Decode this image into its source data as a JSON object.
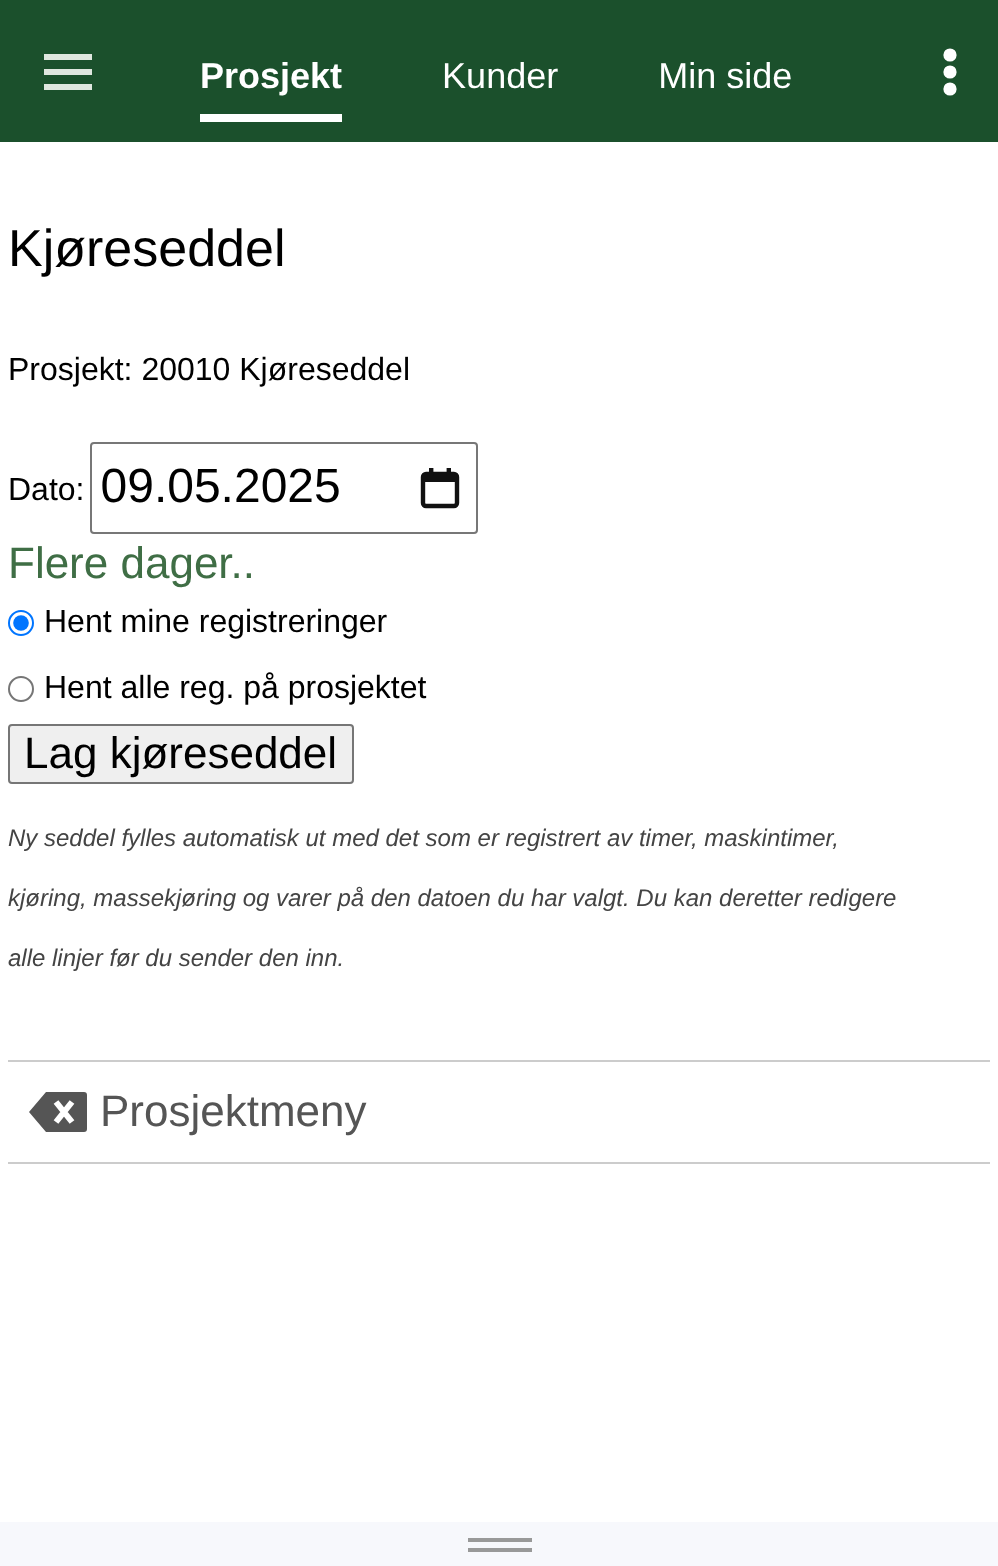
{
  "nav": {
    "tabs": [
      {
        "label": "Prosjekt",
        "selected": true
      },
      {
        "label": "Kunder",
        "selected": false
      },
      {
        "label": "Min side",
        "selected": false
      }
    ]
  },
  "title": "Kjøreseddel",
  "project": "Prosjekt: 20010 Kjøreseddel",
  "date": {
    "label": "Dato:",
    "value": "09.05.2025"
  },
  "more_days": "Flere dager..",
  "options": [
    {
      "label": "Hent mine registreringer",
      "selected": true
    },
    {
      "label": "Hent alle reg. på prosjektet",
      "selected": false
    }
  ],
  "button": "Lag kjøreseddel",
  "note": "Ny seddel fylles automatisk ut med det som er registrert av timer, maskintimer, kjøring, massekjøring og varer på den datoen du har valgt. Du kan deretter redigere alle linjer før du sender den inn.",
  "project_menu": "Prosjektmeny"
}
